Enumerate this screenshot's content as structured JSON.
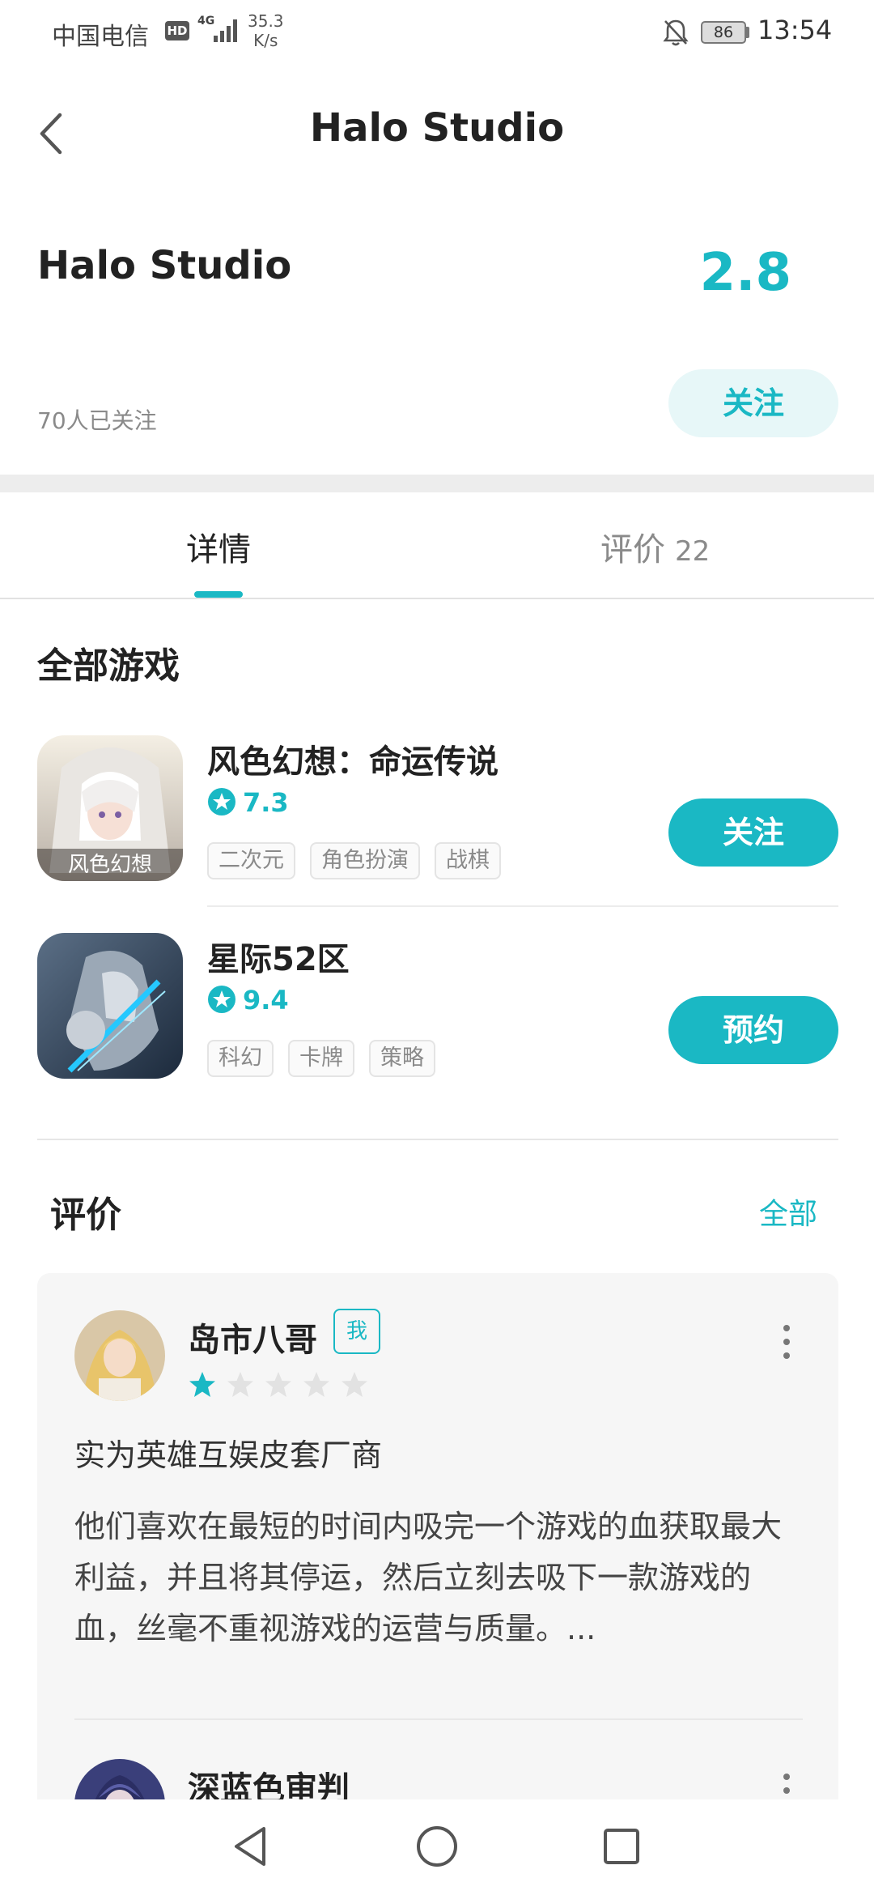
{
  "status_bar": {
    "carrier": "中国电信",
    "hd": "HD",
    "network": "4G",
    "speed_value": "35.3",
    "speed_unit": "K/s",
    "battery": "86",
    "time": "13:54"
  },
  "header": {
    "title": "Halo Studio"
  },
  "studio": {
    "name": "Halo Studio",
    "rating": "2.8",
    "followers": "70人已关注",
    "follow_label": "关注"
  },
  "tabs": [
    {
      "label": "详情",
      "active": true
    },
    {
      "label": "评价",
      "count": "22",
      "active": false
    }
  ],
  "games_section": {
    "heading": "全部游戏",
    "games": [
      {
        "name": "风色幻想：命运传说",
        "rating": "7.3",
        "tags": [
          "二次元",
          "角色扮演",
          "战棋"
        ],
        "action": "关注",
        "icon_text": "风色幻想"
      },
      {
        "name": "星际52区",
        "rating": "9.4",
        "tags": [
          "科幻",
          "卡牌",
          "策略"
        ],
        "action": "预约"
      }
    ]
  },
  "reviews_section": {
    "heading": "评价",
    "all_label": "全部",
    "reviews": [
      {
        "user": "岛市八哥",
        "badge": "我",
        "stars": 1,
        "title": "实为英雄互娱皮套厂商",
        "body": "他们喜欢在最短的时间内吸完一个游戏的血获取最大利益，并且将其停运，然后立刻去吸下一款游戏的血，丝毫不重视游戏的运营与质量。..."
      },
      {
        "user": "深蓝色审判"
      }
    ]
  },
  "colors": {
    "accent": "#1ab8c4",
    "accent_light": "#e7f7f8",
    "star_empty": "#e2e2e2",
    "card_bg": "#f6f6f6"
  }
}
